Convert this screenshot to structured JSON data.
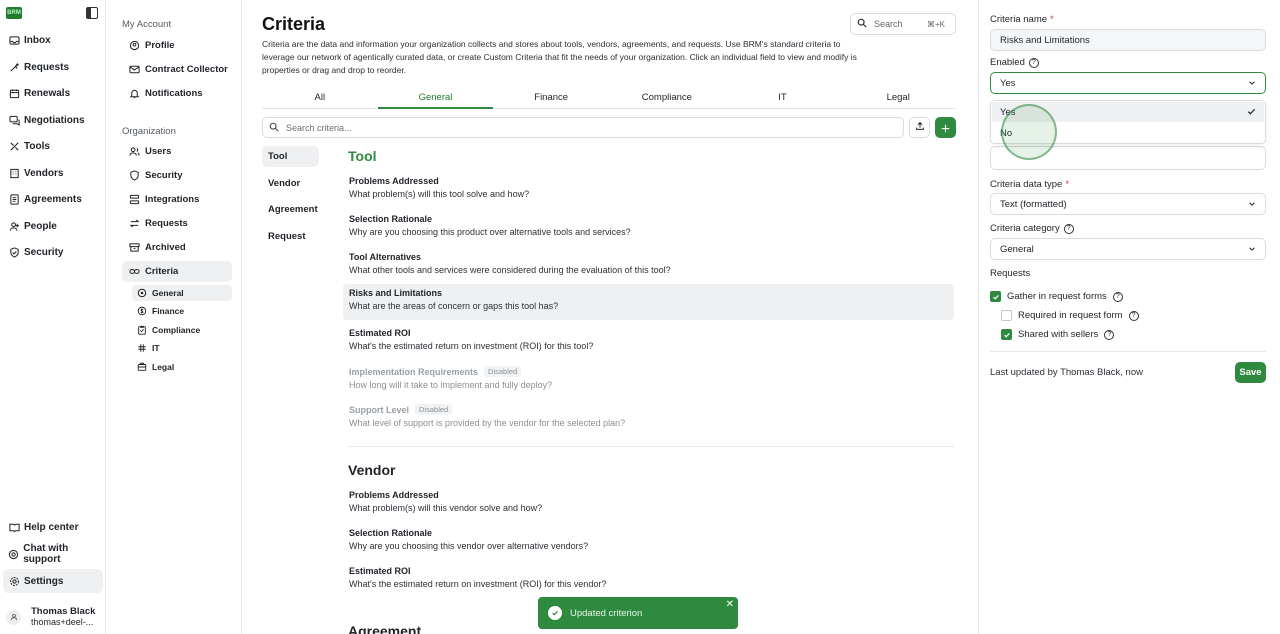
{
  "brand": {
    "logo_text": "BRM",
    "accent": "#2e8a3e"
  },
  "nav": {
    "items": [
      {
        "label": "Inbox",
        "icon": "inbox-icon"
      },
      {
        "label": "Requests",
        "icon": "requests-icon"
      },
      {
        "label": "Renewals",
        "icon": "calendar-icon"
      },
      {
        "label": "Negotiations",
        "icon": "chat-icon"
      },
      {
        "label": "Tools",
        "icon": "tools-icon"
      },
      {
        "label": "Vendors",
        "icon": "building-icon"
      },
      {
        "label": "Agreements",
        "icon": "document-icon"
      },
      {
        "label": "People",
        "icon": "people-icon"
      },
      {
        "label": "Security",
        "icon": "shield-icon"
      }
    ],
    "bottom": [
      {
        "label": "Help center",
        "icon": "book-icon"
      },
      {
        "label": "Chat with support",
        "icon": "support-icon"
      },
      {
        "label": "Settings",
        "icon": "gear-icon"
      }
    ],
    "user": {
      "name": "Thomas Black",
      "email": "thomas+deel-..."
    }
  },
  "settings_nav": {
    "my_account_heading": "My Account",
    "my_account": [
      {
        "label": "Profile",
        "icon": "profile-icon"
      },
      {
        "label": "Contract Collector",
        "icon": "mail-icon"
      },
      {
        "label": "Notifications",
        "icon": "bell-icon"
      }
    ],
    "organization_heading": "Organization",
    "organization": [
      {
        "label": "Users",
        "icon": "users-icon"
      },
      {
        "label": "Security",
        "icon": "shield-icon"
      },
      {
        "label": "Integrations",
        "icon": "integrations-icon"
      },
      {
        "label": "Requests",
        "icon": "swap-icon"
      },
      {
        "label": "Archived",
        "icon": "archive-icon"
      },
      {
        "label": "Criteria",
        "icon": "link-icon"
      }
    ],
    "criteria_children": [
      {
        "label": "General",
        "icon": "compass-icon"
      },
      {
        "label": "Finance",
        "icon": "dollar-icon"
      },
      {
        "label": "Compliance",
        "icon": "clipboard-icon"
      },
      {
        "label": "IT",
        "icon": "hash-icon"
      },
      {
        "label": "Legal",
        "icon": "scales-icon"
      }
    ]
  },
  "main": {
    "title": "Criteria",
    "description": "Criteria are the data and information your organization collects and stores about tools, vendors, agreements, and requests. Use BRM's standard criteria to leverage our network of agentically curated data, or create Custom Criteria that fit the needs of your organization. Click an individual field to view and modify is properties or drag and drop to reorder.",
    "top_search": {
      "placeholder": "Search",
      "shortcut": "⌘+K"
    },
    "tabs": [
      "All",
      "General",
      "Finance",
      "Compliance",
      "IT",
      "Legal"
    ],
    "search_placeholder": "Search criteria...",
    "categories": [
      "Tool",
      "Vendor",
      "Agreement",
      "Request"
    ],
    "sections": [
      {
        "title": "Tool",
        "items": [
          {
            "title": "Problems Addressed",
            "desc": "What problem(s) will this tool solve and how?"
          },
          {
            "title": "Selection Rationale",
            "desc": "Why are you choosing this product over alternative tools and services?"
          },
          {
            "title": "Tool Alternatives",
            "desc": "What other tools and services were considered during the evaluation of this tool?"
          },
          {
            "title": "Risks and Limitations",
            "desc": "What are the areas of concern or gaps this tool has?"
          },
          {
            "title": "Estimated ROI",
            "desc": "What's the estimated return on investment (ROI) for this tool?"
          },
          {
            "title": "Implementation Requirements",
            "desc": "How long will it take to implement and fully deploy?",
            "badge": "Disabled"
          },
          {
            "title": "Support Level",
            "desc": "What level of support is provided by the vendor for the selected plan?",
            "badge": "Disabled"
          }
        ]
      },
      {
        "title": "Vendor",
        "items": [
          {
            "title": "Problems Addressed",
            "desc": "What problem(s) will this vendor solve and how?"
          },
          {
            "title": "Selection Rationale",
            "desc": "Why are you choosing this vendor over alternative vendors?"
          },
          {
            "title": "Estimated ROI",
            "desc": "What's the estimated return on investment (ROI) for this vendor?"
          }
        ]
      },
      {
        "title": "Agreement",
        "items": []
      }
    ],
    "toast": {
      "message": "Updated criterion",
      "close": "✕"
    }
  },
  "panel": {
    "name_label": "Criteria name",
    "name_value": "Risks and Limitations",
    "enabled_label": "Enabled",
    "enabled_value": "Yes",
    "enabled_options": [
      "Yes",
      "No"
    ],
    "type_label": "Criteria data type",
    "type_value": "Text (formatted)",
    "category_label": "Criteria category",
    "category_value": "General",
    "requests_label": "Requests",
    "checks": [
      {
        "label": "Gather in request forms",
        "checked": true
      },
      {
        "label": "Required in request form",
        "checked": false
      },
      {
        "label": "Shared with sellers",
        "checked": true
      }
    ],
    "updated_text": "Last updated by Thomas Black, now",
    "save_label": "Save",
    "required_mark": "*"
  }
}
